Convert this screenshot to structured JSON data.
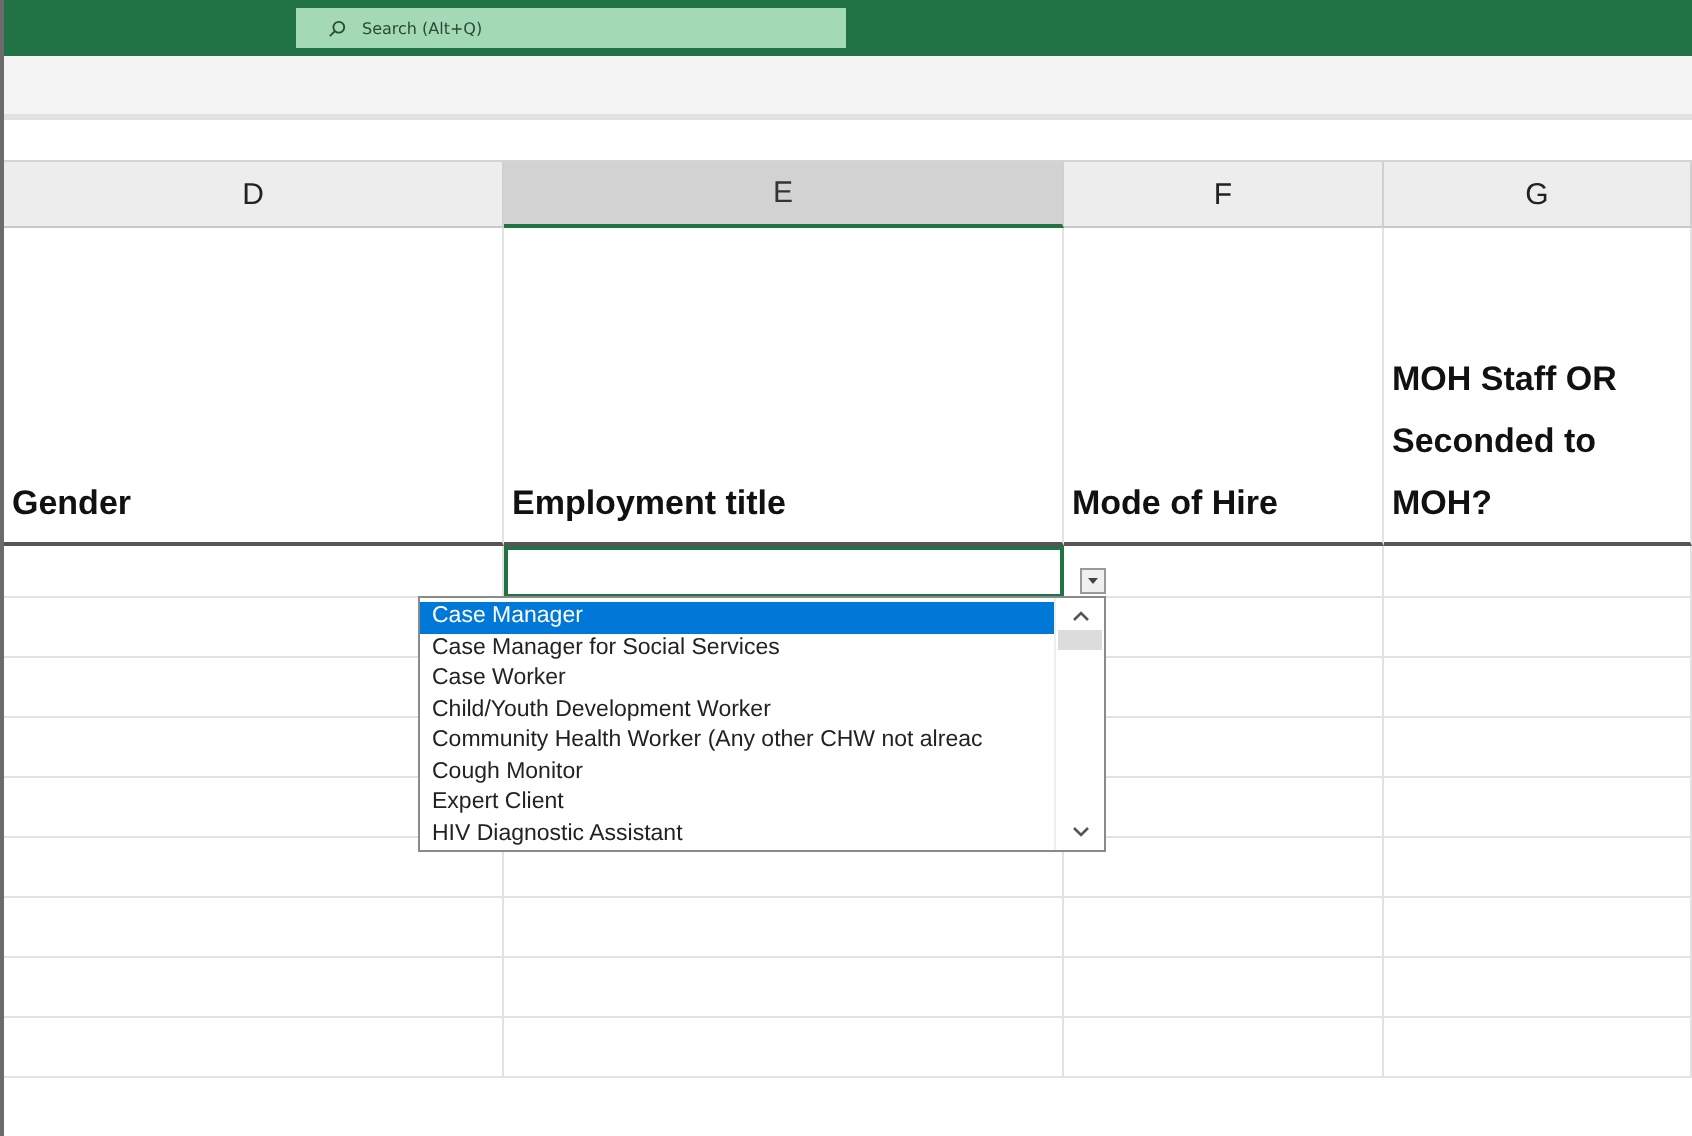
{
  "search": {
    "placeholder": "Search (Alt+Q)"
  },
  "columns": [
    {
      "label": "D",
      "selected": false
    },
    {
      "label": "E",
      "selected": true
    },
    {
      "label": "F",
      "selected": false
    },
    {
      "label": "G",
      "selected": false
    }
  ],
  "headers": [
    "Gender",
    "Employment title",
    "Mode of Hire",
    "MOH Staff OR Seconded to MOH?"
  ],
  "dropdown": {
    "items": [
      {
        "label": "Case Manager",
        "selected": true
      },
      {
        "label": "Case Manager for Social Services",
        "selected": false
      },
      {
        "label": "Case Worker",
        "selected": false
      },
      {
        "label": "Child/Youth Development Worker",
        "selected": false
      },
      {
        "label": "Community Health Worker (Any other CHW not alreac",
        "selected": false
      },
      {
        "label": "Cough Monitor",
        "selected": false
      },
      {
        "label": "Expert Client",
        "selected": false
      },
      {
        "label": "HIV Diagnostic Assistant",
        "selected": false
      }
    ]
  }
}
